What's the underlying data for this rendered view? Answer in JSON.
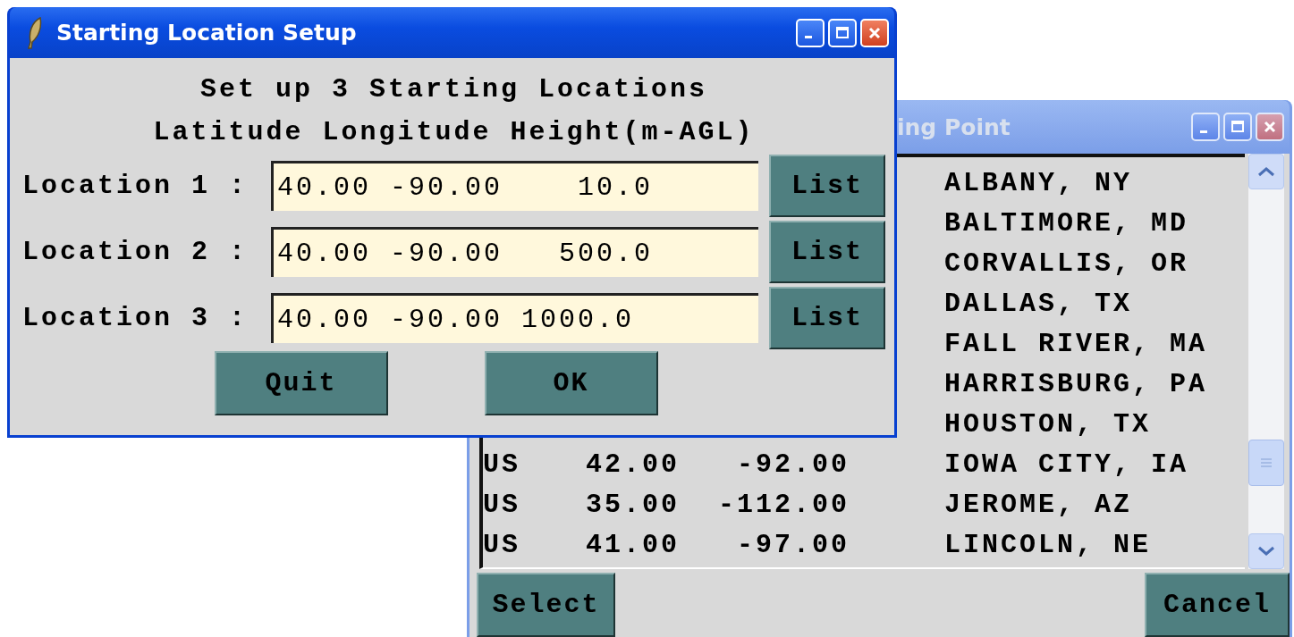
{
  "back_window": {
    "title": "ing Point",
    "active": false,
    "rows": [
      {
        "city": "ALBANY, NY"
      },
      {
        "city": "BALTIMORE, MD"
      },
      {
        "city": "CORVALLIS, OR"
      },
      {
        "city": "DALLAS, TX"
      },
      {
        "city": "FALL RIVER, MA"
      },
      {
        "city": "HARRISBURG, PA"
      },
      {
        "city": "HOUSTON, TX"
      },
      {
        "country": "US",
        "lat": "42.00",
        "lon": "-92.00",
        "city": "IOWA CITY, IA"
      },
      {
        "country": "US",
        "lat": "35.00",
        "lon": "-112.00",
        "city": "JEROME, AZ"
      },
      {
        "country": "US",
        "lat": "41.00",
        "lon": "-97.00",
        "city": "LINCOLN, NE"
      }
    ],
    "buttons": [
      "Select",
      "Cancel"
    ]
  },
  "front_window": {
    "title": "Starting Location Setup",
    "active": true,
    "heading": "Set up 3 Starting Locations",
    "columns_label": "Latitude Longitude Height(m-AGL)",
    "locations": [
      {
        "label": "Location 1 :",
        "value": "40.00 -90.00    10.0",
        "button": "List"
      },
      {
        "label": "Location 2 :",
        "value": "40.00 -90.00   500.0",
        "button": "List"
      },
      {
        "label": "Location 3 :",
        "value": "40.00 -90.00 1000.0",
        "button": "List"
      }
    ],
    "buttons": [
      "Quit",
      "OK"
    ]
  }
}
